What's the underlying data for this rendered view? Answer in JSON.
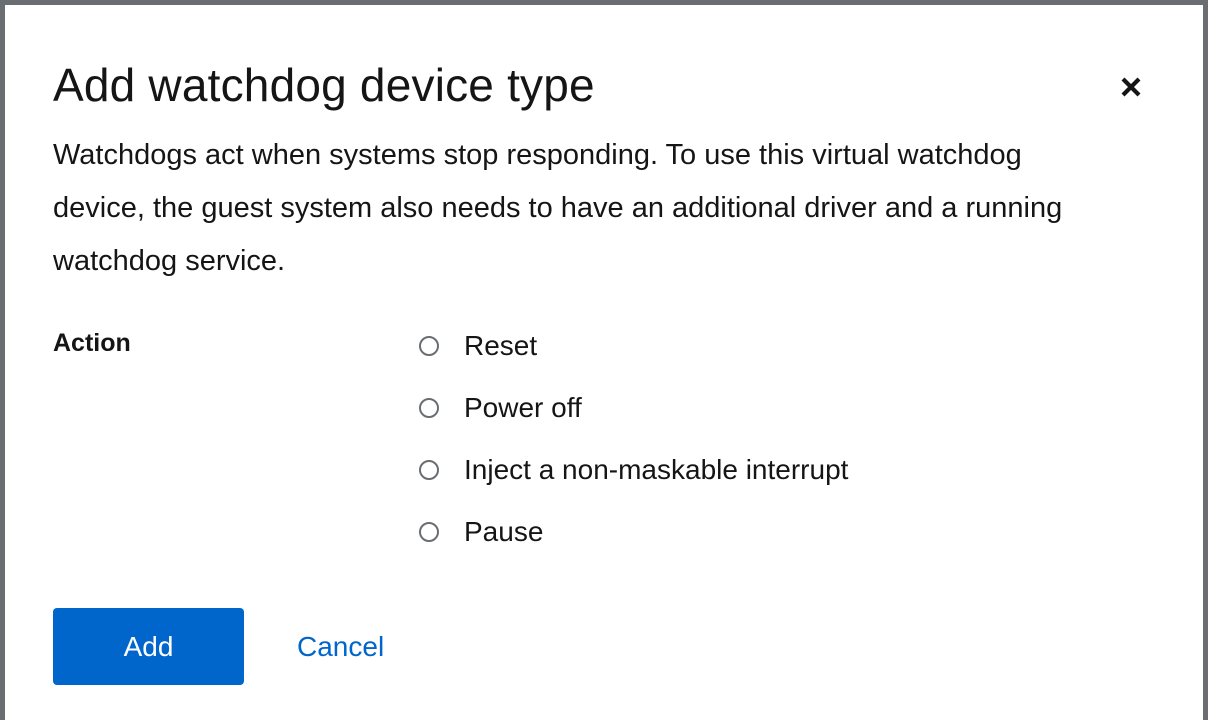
{
  "dialog": {
    "title": "Add watchdog device type",
    "close_icon": "close-icon",
    "description": "Watchdogs act when systems stop responding. To use this virtual watchdog device, the guest system also needs to have an additional driver and a running watchdog service."
  },
  "form": {
    "action_label": "Action",
    "options": [
      {
        "label": "Reset",
        "checked": false
      },
      {
        "label": "Power off",
        "checked": false
      },
      {
        "label": "Inject a non-maskable interrupt",
        "checked": false
      },
      {
        "label": "Pause",
        "checked": false
      }
    ]
  },
  "footer": {
    "add_label": "Add",
    "cancel_label": "Cancel"
  },
  "colors": {
    "primary": "#0066cc",
    "text": "#151515",
    "border": "#6a6e73"
  }
}
